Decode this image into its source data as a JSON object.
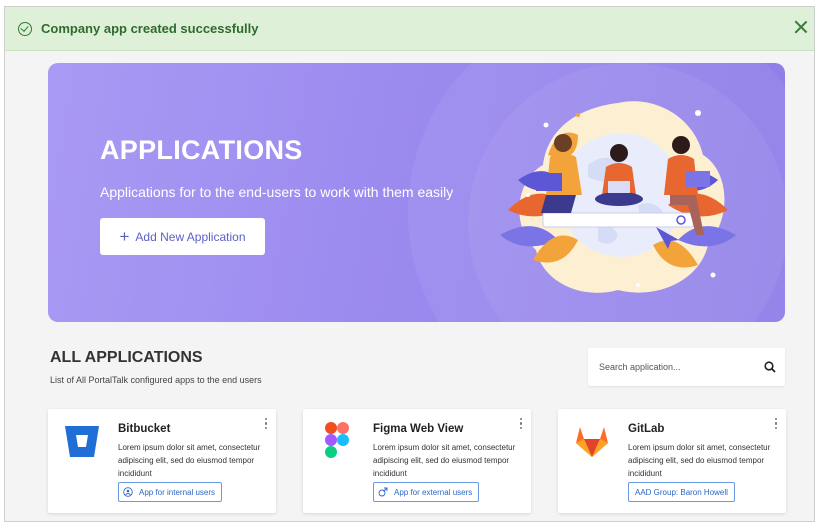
{
  "notification": {
    "message": "Company app created successfully"
  },
  "hero": {
    "title": "APPLICATIONS",
    "subtitle": "Applications for to the end-users  to work with them easily",
    "add_button_label": "Add New Application"
  },
  "section": {
    "title": "ALL APPLICATIONS",
    "subtitle": "List of All PortalTalk configured apps to the end users"
  },
  "search": {
    "placeholder": "Search application..."
  },
  "apps": [
    {
      "name": "Bitbucket",
      "icon": "bitbucket-logo",
      "description": "Lorem ipsum dolor sit amet, consectetur adipiscing elit, sed do eiusmod tempor incididunt",
      "tag": "App for internal users",
      "tag_icon": "people-icon"
    },
    {
      "name": "Figma Web View",
      "icon": "figma-logo",
      "description": "Lorem ipsum dolor sit amet, consectetur adipiscing elit, sed do eiusmod tempor incididunt",
      "tag": "App for external users",
      "tag_icon": "link-icon"
    },
    {
      "name": "GitLab",
      "icon": "gitlab-logo",
      "description": "Lorem ipsum dolor sit amet, consectetur adipiscing elit, sed do eiusmod tempor incididunt",
      "tag": "AAD Group: Baron Howell",
      "tag_icon": ""
    }
  ],
  "colors": {
    "hero": "#9c8bef",
    "success_bg": "#dff0d8",
    "success_text": "#2e6b2e",
    "accent": "#5b5fc7",
    "tag_border": "#6a9be0"
  }
}
